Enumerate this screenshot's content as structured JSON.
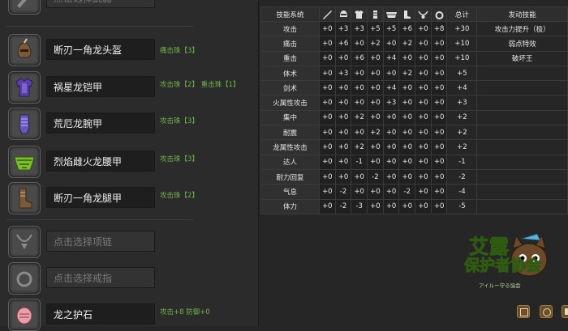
{
  "equipment": {
    "weapon": {
      "name": "点击选择武器",
      "icon": "weapon-icon"
    },
    "helm": {
      "name": "断刃一角龙头盔",
      "skills": "痛击珠【3】",
      "icon": "helm-icon"
    },
    "chest": {
      "name": "祸星龙铠甲",
      "skills": "攻击珠【2】 重击珠【1】",
      "icon": "chest-icon"
    },
    "arms": {
      "name": "荒厄龙腕甲",
      "skills": "攻击珠【3】",
      "icon": "gauntlet-icon"
    },
    "waist": {
      "name": "烈焰雌火龙腰甲",
      "skills": "攻击珠【3】",
      "icon": "waist-icon"
    },
    "legs": {
      "name": "断刃一角龙腿甲",
      "skills": "攻击珠【2】",
      "icon": "greaves-icon"
    },
    "necklace": {
      "name": "点击选择项链",
      "icon": "necklace-icon"
    },
    "ring": {
      "name": "点击选择戒指",
      "icon": "ring-icon"
    },
    "talisman": {
      "name": "龙之护石",
      "skills": "攻击+8 防御+0",
      "icon": "talisman-icon"
    }
  },
  "table": {
    "header": {
      "skill": "技能系统",
      "total": "总计",
      "activated": "发动技能"
    },
    "header_icons": [
      "weapon-icon",
      "helm-icon",
      "chest-icon",
      "gauntlet-icon",
      "waist-icon",
      "greaves-icon",
      "necklace-icon",
      "ring-icon"
    ],
    "rows": [
      {
        "skill": "攻击",
        "values": [
          "+0",
          "+3",
          "+3",
          "+5",
          "+5",
          "+6",
          "+0",
          "+8"
        ],
        "total": "+30",
        "activated": "攻击力提升（极）"
      },
      {
        "skill": "痛击",
        "values": [
          "+0",
          "+6",
          "+0",
          "+2",
          "+0",
          "+2",
          "+0",
          "+0"
        ],
        "total": "+10",
        "activated": "弱点特效"
      },
      {
        "skill": "重击",
        "values": [
          "+0",
          "+0",
          "+6",
          "+0",
          "+4",
          "+0",
          "+0",
          "+0"
        ],
        "total": "+10",
        "activated": "破坏王"
      },
      {
        "skill": "体术",
        "values": [
          "+0",
          "+3",
          "+0",
          "+0",
          "+0",
          "+2",
          "+0",
          "+0"
        ],
        "total": "+5",
        "activated": ""
      },
      {
        "skill": "剑术",
        "values": [
          "+0",
          "+0",
          "+0",
          "+0",
          "+4",
          "+0",
          "+0",
          "+0"
        ],
        "total": "+4",
        "activated": ""
      },
      {
        "skill": "火属性攻击",
        "values": [
          "+0",
          "+0",
          "+0",
          "+0",
          "+3",
          "+0",
          "+0",
          "+0"
        ],
        "total": "+3",
        "activated": ""
      },
      {
        "skill": "集中",
        "values": [
          "+0",
          "+0",
          "+2",
          "+0",
          "+0",
          "+0",
          "+0",
          "+0"
        ],
        "total": "+2",
        "activated": ""
      },
      {
        "skill": "耐震",
        "values": [
          "+0",
          "+0",
          "+0",
          "+2",
          "+0",
          "+0",
          "+0",
          "+0"
        ],
        "total": "+2",
        "activated": ""
      },
      {
        "skill": "龙属性攻击",
        "values": [
          "+0",
          "+0",
          "+2",
          "+0",
          "+0",
          "+0",
          "+0",
          "+0"
        ],
        "total": "+2",
        "activated": ""
      },
      {
        "skill": "达人",
        "values": [
          "+0",
          "+0",
          "-1",
          "+0",
          "+0",
          "+0",
          "+0",
          "+0"
        ],
        "total": "-1",
        "activated": ""
      },
      {
        "skill": "耐力回复",
        "values": [
          "+0",
          "+0",
          "+0",
          "-2",
          "+0",
          "+0",
          "+0",
          "+0"
        ],
        "total": "-2",
        "activated": ""
      },
      {
        "skill": "气息",
        "values": [
          "+0",
          "-2",
          "+0",
          "+0",
          "+0",
          "-2",
          "+0",
          "+0"
        ],
        "total": "-4",
        "activated": ""
      },
      {
        "skill": "体力",
        "values": [
          "+0",
          "-2",
          "-3",
          "+0",
          "+0",
          "+0",
          "+0",
          "+0"
        ],
        "total": "-5",
        "activated": ""
      }
    ]
  },
  "logo": {
    "line1": "艾露",
    "line2": "保护者协会",
    "line3": "アイルー守る協会"
  },
  "buttons": [
    "save-icon",
    "refresh-icon",
    "share-icon"
  ]
}
